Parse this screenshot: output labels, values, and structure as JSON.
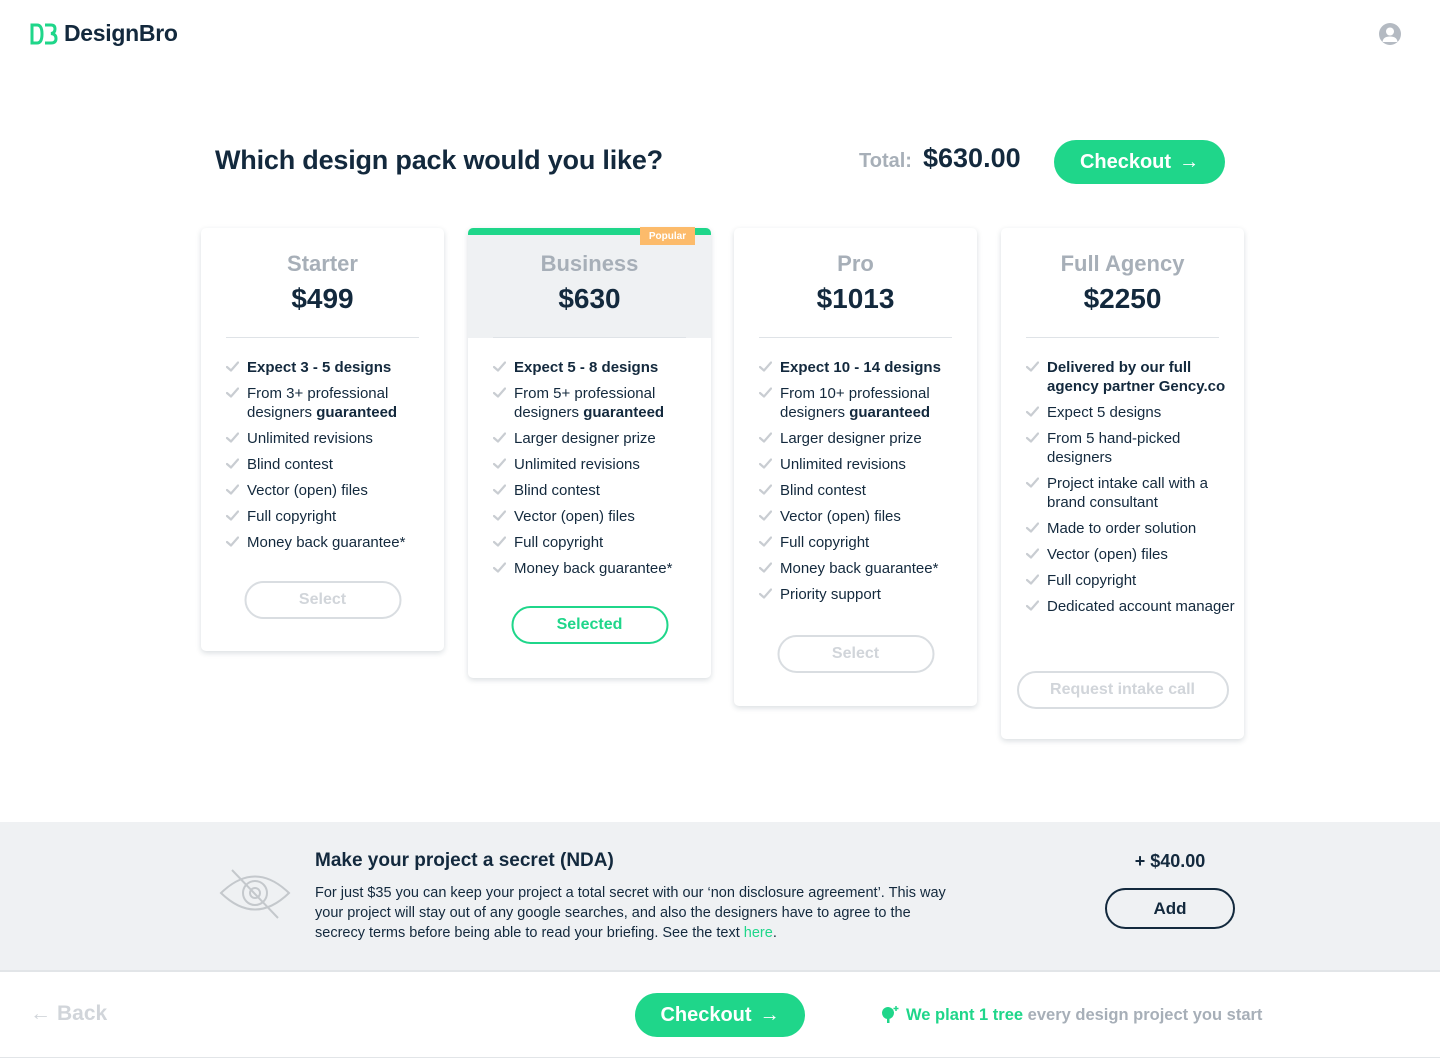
{
  "header": {
    "logo_text": "DesignBro",
    "logo_mark": "DB",
    "avatar_icon": "user-avatar-icon"
  },
  "main": {
    "headline": "Which design pack would you like?",
    "total_label": "Total:",
    "total_value": "$630.00",
    "checkout_label": "Checkout",
    "checkout_arrow": "→"
  },
  "colors": {
    "accent": "#1fd68a",
    "navy": "#13293d",
    "muted": "#a7afb8",
    "popular": "#fcbb6b",
    "band": "#eff1f3"
  },
  "plans": [
    {
      "name": "Starter",
      "price": "$499",
      "features": [
        {
          "bold": "Expect 3 - 5 designs",
          "text": ""
        },
        {
          "text": "From 3+ professional designers ",
          "bold_suffix": "guaranteed"
        },
        {
          "text": "Unlimited revisions"
        },
        {
          "text": "Blind contest"
        },
        {
          "text": "Vector (open) files"
        },
        {
          "text": "Full copyright"
        },
        {
          "text": "Money back guarantee*"
        }
      ],
      "button": "Select",
      "state": "default"
    },
    {
      "name": "Business",
      "price": "$630",
      "badge": "Popular",
      "features": [
        {
          "bold": "Expect 5 - 8 designs",
          "text": ""
        },
        {
          "text": "From 5+ professional designers ",
          "bold_suffix": "guaranteed"
        },
        {
          "text": "Larger designer prize"
        },
        {
          "text": "Unlimited revisions"
        },
        {
          "text": "Blind contest"
        },
        {
          "text": "Vector (open) files"
        },
        {
          "text": "Full copyright"
        },
        {
          "text": "Money back guarantee*"
        }
      ],
      "button": "Selected",
      "state": "selected"
    },
    {
      "name": "Pro",
      "price": "$1013",
      "features": [
        {
          "bold": "Expect 10 - 14 designs",
          "text": ""
        },
        {
          "text": "From 10+ professional designers ",
          "bold_suffix": "guaranteed"
        },
        {
          "text": "Larger designer prize"
        },
        {
          "text": "Unlimited revisions"
        },
        {
          "text": "Blind contest"
        },
        {
          "text": "Vector (open) files"
        },
        {
          "text": "Full copyright"
        },
        {
          "text": "Money back guarantee*"
        },
        {
          "text": "Priority support"
        }
      ],
      "button": "Select",
      "state": "default"
    },
    {
      "name": "Full Agency",
      "price": "$2250",
      "features": [
        {
          "bold": "Delivered by our full agency partner Gency.co",
          "text": ""
        },
        {
          "text": "Expect 5 designs"
        },
        {
          "text": "From 5 hand-picked designers"
        },
        {
          "text": "Project intake call with a brand consultant"
        },
        {
          "text": "Made to order solution"
        },
        {
          "text": "Vector (open) files"
        },
        {
          "text": "Full copyright"
        },
        {
          "text": "Dedicated account manager"
        }
      ],
      "button": "Request intake call",
      "state": "default"
    }
  ],
  "nda": {
    "icon": "eye-slash-icon",
    "title": "Make your project a secret (NDA)",
    "text": "For just $35 you can keep your project a total secret with our ‘non disclosure agreement’. This way your project will stay out of any google searches, and also the designers have to agree to the secrecy terms before being able to read your briefing. See the text ",
    "link_text": "here",
    "text_end": ".",
    "price": "+ $40.00",
    "add_label": "Add"
  },
  "footer": {
    "back_arrow": "←",
    "back_label": "Back",
    "checkout_label": "Checkout",
    "checkout_arrow": "→",
    "tree_icon": "tree-plus-icon",
    "tree_highlight": "We plant 1 tree",
    "tree_rest": " every design project you start"
  }
}
